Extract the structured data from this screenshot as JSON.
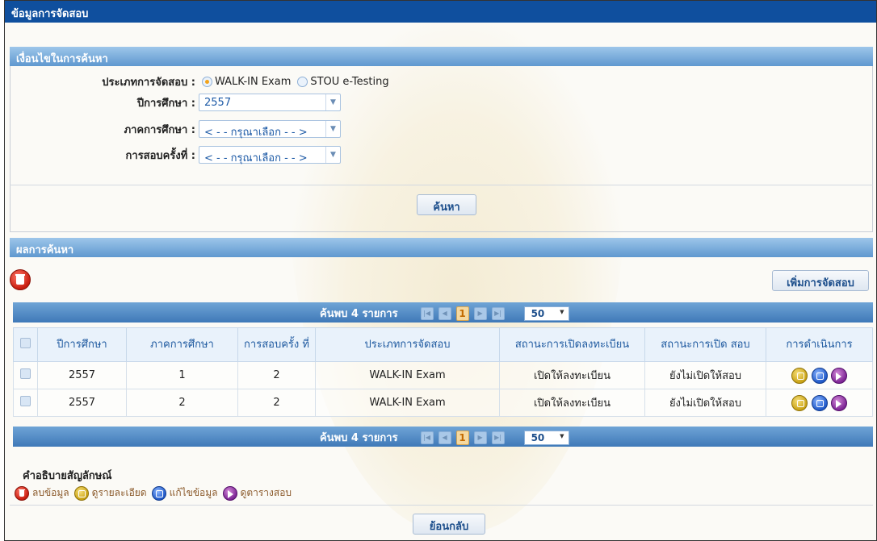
{
  "title": "ข้อมูลการจัดสอบ",
  "search": {
    "header": "เงื่อนไขในการค้นหา",
    "exam_type_label": "ประเภทการจัดสอบ :",
    "radio_options": [
      "WALK-IN Exam",
      "STOU e-Testing"
    ],
    "selected_option": "WALK-IN Exam",
    "year_label": "ปีการศึกษา :",
    "year_value": "2557",
    "semester_label": "ภาคการศึกษา :",
    "semester_value": "< - - กรุณาเลือก - - >",
    "round_label": "การสอบครั้งที่ :",
    "round_value": "< - - กรุณาเลือก - - >",
    "search_button": "ค้นหา"
  },
  "results": {
    "header": "ผลการค้นหา",
    "add_button": "เพิ่มการจัดสอบ",
    "pager": {
      "found_text": "ค้นพบ 4 รายการ",
      "current_page": "1",
      "page_size": "50"
    },
    "columns": [
      "ปีการศึกษา",
      "ภาคการศึกษา",
      "การสอบครั้ง ที่",
      "ประเภทการจัดสอบ",
      "สถานะการเปิดลงทะเบียน",
      "สถานะการเปิด สอบ",
      "การดำเนินการ"
    ],
    "rows": [
      {
        "year": "2557",
        "semester": "1",
        "round": "2",
        "type": "WALK-IN Exam",
        "reg_status": "เปิดให้ลงทะเบียน",
        "exam_status": "ยังไม่เปิดให้สอบ"
      },
      {
        "year": "2557",
        "semester": "2",
        "round": "2",
        "type": "WALK-IN Exam",
        "reg_status": "เปิดให้ลงทะเบียน",
        "exam_status": "ยังไม่เปิดให้สอบ"
      }
    ]
  },
  "legend": {
    "title": "คำอธิบายสัญลักษณ์",
    "items": [
      {
        "icon": "delete-icon",
        "label": "ลบข้อมูล"
      },
      {
        "icon": "view-detail-icon",
        "label": "ดูรายละเอียด"
      },
      {
        "icon": "edit-icon",
        "label": "แก้ไขข้อมูล"
      },
      {
        "icon": "schedule-icon",
        "label": "ดูตารางสอบ"
      }
    ]
  },
  "back_button": "ย้อนกลับ",
  "colors": {
    "title_bar": "#0f4f9e",
    "section_header": "#5f98cf",
    "pager_bar": "#3f79b8",
    "delete": "#c81c0e",
    "view": "#c9a214",
    "edit": "#1f58c8",
    "schedule": "#7d2595"
  }
}
